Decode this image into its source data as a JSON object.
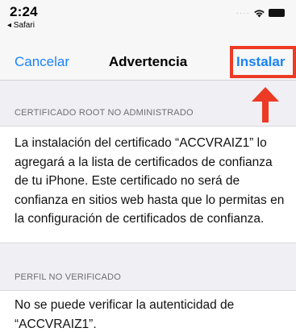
{
  "status_bar": {
    "time": "2:24",
    "back_app": "◂ Safari",
    "signal_icon": "dots-signal-icon",
    "wifi_icon": "wifi-icon",
    "battery_icon": "battery-icon"
  },
  "nav": {
    "cancel_label": "Cancelar",
    "title": "Advertencia",
    "install_label": "Instalar"
  },
  "annotation": {
    "highlight_color": "#ec3a24",
    "arrow_icon": "up-arrow-icon"
  },
  "sections": [
    {
      "header": "CERTIFICADO ROOT NO ADMINISTRADO",
      "body": "La instalación del certificado “ACCVRAIZ1” lo agregará a la lista de certificados de confianza de tu iPhone. Este certificado no será de confianza en sitios web hasta que lo permitas en la configuración de certificados de confianza."
    },
    {
      "header": "PERFIL NO VERIFICADO",
      "body": "No se puede verificar la autenticidad de “ACCVRAIZ1”."
    }
  ],
  "colors": {
    "accent": "#1a82fb",
    "background": "#efeff4"
  }
}
